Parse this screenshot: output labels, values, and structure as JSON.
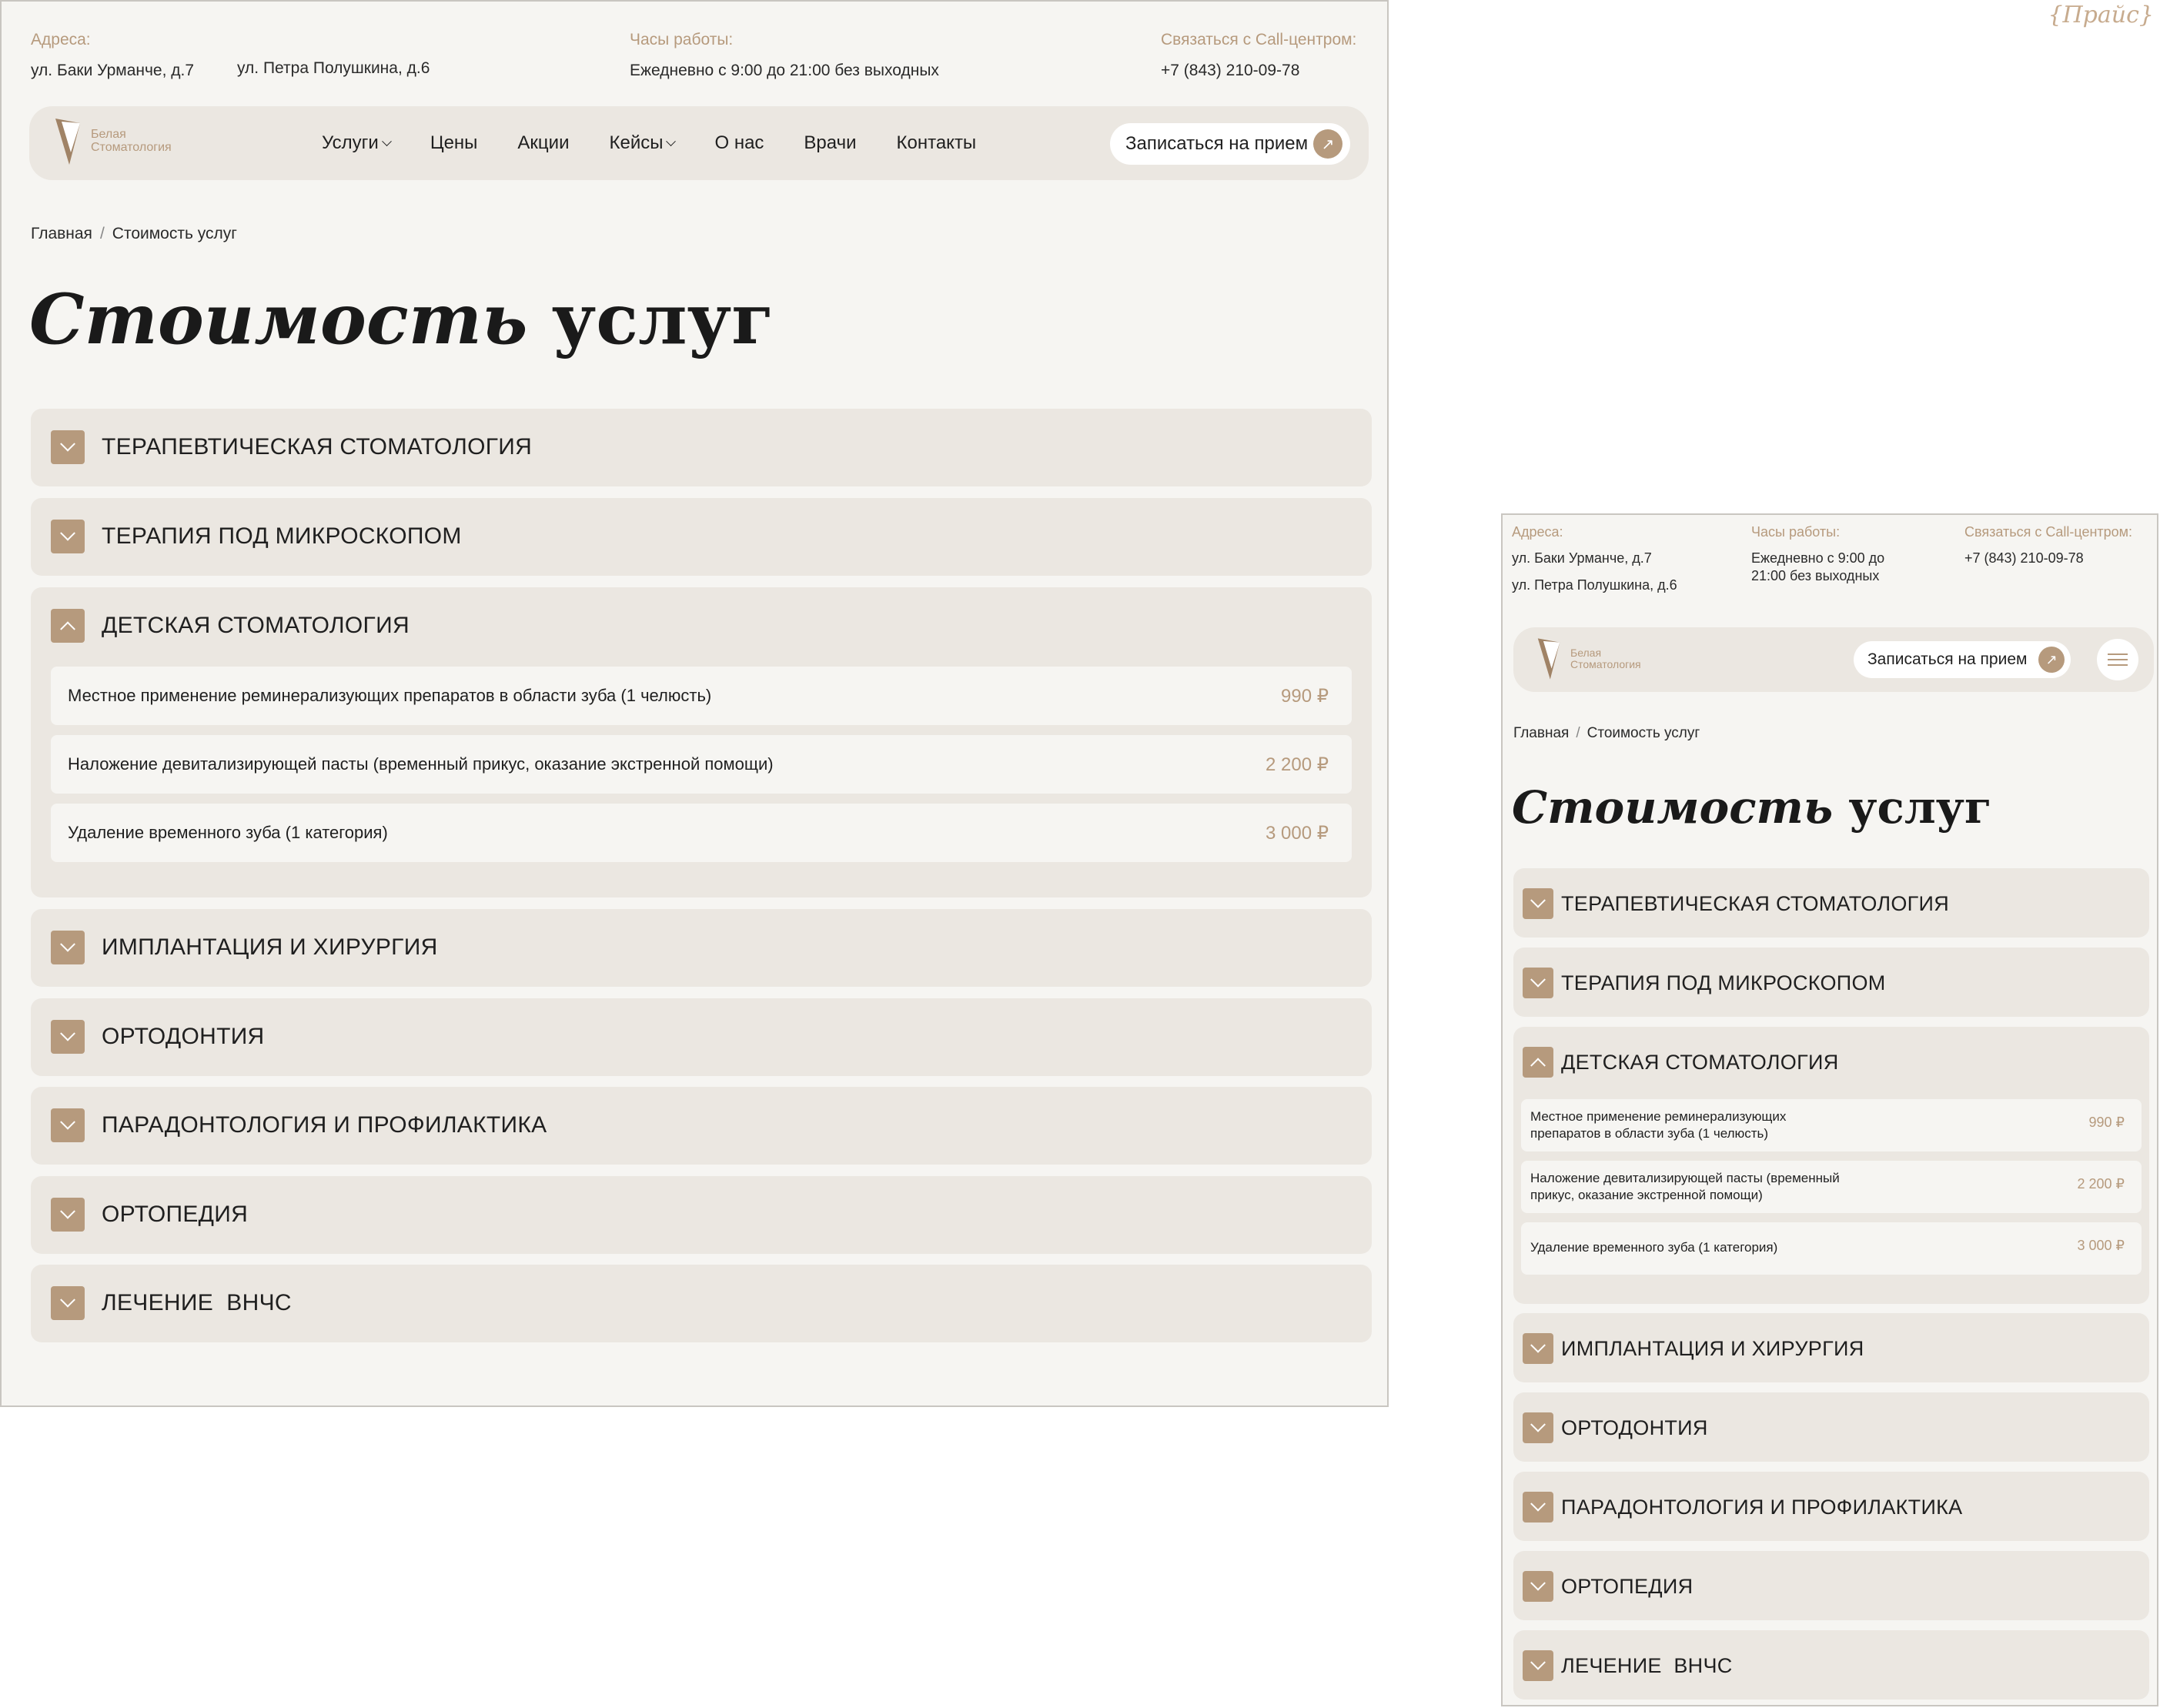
{
  "watermark": "{Прайс}",
  "desktop": {
    "contacts": {
      "address_label": "Адреса:",
      "address_1": "ул. Баки Урманче, д.7",
      "address_2": "ул. Петра Полушкина, д.6",
      "hours_label": "Часы работы:",
      "hours_value": "Ежедневно с 9:00 до 21:00 без выходных",
      "call_label": "Связаться с Call-центром:",
      "call_value": "+7 (843) 210-09-78"
    },
    "logo": {
      "line1": "Белая",
      "line2": "Стоматология"
    },
    "menu": [
      "Услуги",
      "Цены",
      "Акции",
      "Кейсы",
      "О нас",
      "Врачи",
      "Контакты"
    ],
    "cta": "Записаться на прием",
    "breadcrumb": {
      "home": "Главная",
      "sep": "/",
      "current": "Стоимость услуг"
    },
    "title_italic": "Стоимость",
    "title_regular": "услуг"
  },
  "categories": [
    "ТЕРАПЕВТИЧЕСКАЯ СТОМАТОЛОГИЯ",
    "ТЕРАПИЯ ПОД МИКРОСКОПОМ",
    "ДЕТСКАЯ СТОМАТОЛОГИЯ",
    "ИМПЛАНТАЦИЯ И ХИРУРГИЯ",
    "ОРТОДОНТИЯ",
    "ПАРАДОНТОЛОГИЯ И ПРОФИЛАКТИКА",
    "ОРТОПЕДИЯ",
    "ЛЕЧЕНИЕ  ВНЧС"
  ],
  "services": [
    {
      "name": "Местное применение реминерализующих препаратов в области зуба (1 челюсть)",
      "name_mobile_1": "Местное применение реминерализующих",
      "name_mobile_2": "препаратов в области зуба (1 челюсть)",
      "price": "990 ₽"
    },
    {
      "name": "Наложение девитализирующей пасты (временный прикус, оказание экстренной помощи)",
      "name_mobile_1": "Наложение девитализирующей пасты (временный",
      "name_mobile_2": "прикус, оказание экстренной помощи)",
      "price": "2 200 ₽"
    },
    {
      "name": "Удаление временного зуба (1 категория)",
      "name_mobile_1": "Удаление временного зуба (1 категория)",
      "name_mobile_2": "",
      "price": "3 000 ₽"
    }
  ],
  "mobile": {
    "address_label": "Адреса:",
    "address_1": "ул. Баки Урманче, д.7",
    "address_2": "ул. Петра Полушкина, д.6",
    "hours_label": "Часы работы:",
    "hours_line1": "Ежедневно с 9:00 до",
    "hours_line2": "21:00 без выходных",
    "call_label": "Связаться с Call-центром:",
    "call_value": "+7 (843) 210-09-78"
  },
  "colors": {
    "accent": "#b69a7d",
    "panel": "#ebe7e1",
    "page": "#f6f5f2"
  },
  "icons": {
    "expand": "chevron-down-icon",
    "collapse": "chevron-up-icon",
    "cta": "arrow-up-right-icon",
    "menu": "hamburger-icon"
  }
}
